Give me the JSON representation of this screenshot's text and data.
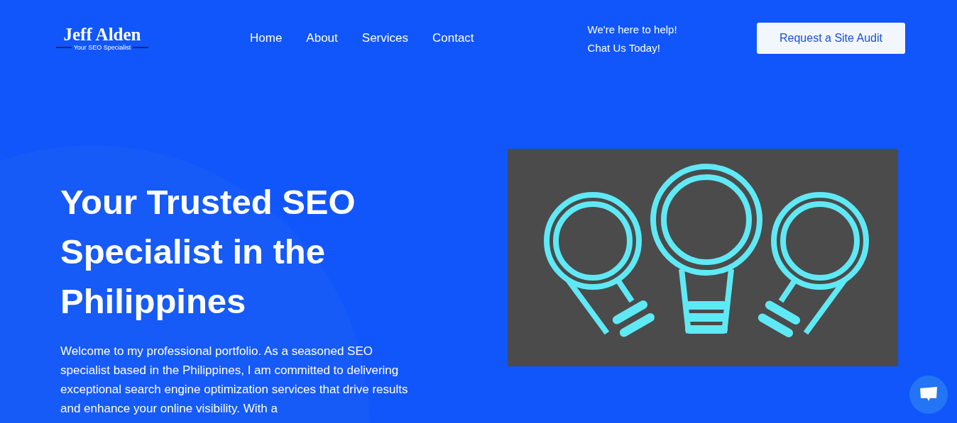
{
  "logo": {
    "name": "Jeff Alden",
    "tagline": "Your SEO Specialist"
  },
  "nav": [
    {
      "label": "Home"
    },
    {
      "label": "About"
    },
    {
      "label": "Services"
    },
    {
      "label": "Contact"
    }
  ],
  "help": {
    "line_1": "We're here to help!",
    "line_2": "Chat Us Today!"
  },
  "cta_button": "Request a Site Audit",
  "hero": {
    "title": "Your Trusted SEO Specialist in the Philippines",
    "intro": "Welcome to my professional portfolio. As a seasoned SEO specialist based in the Philippines, I am committed to delivering exceptional search engine optimization services that drive results and enhance your online visibility. With a"
  }
}
